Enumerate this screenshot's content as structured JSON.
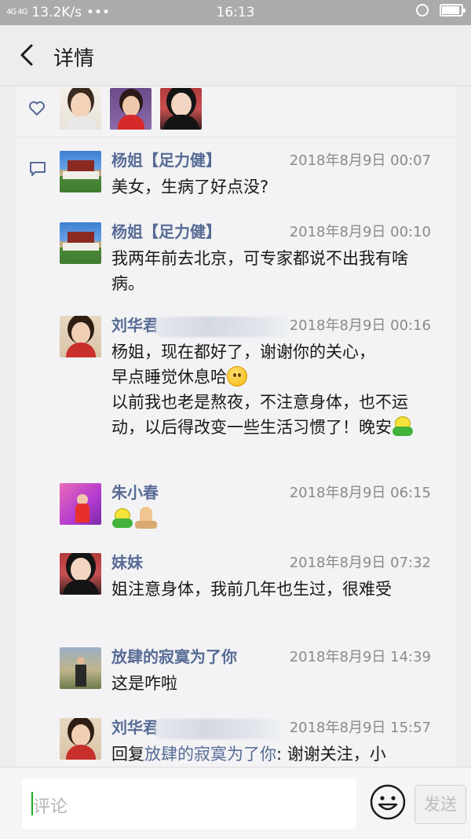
{
  "status_bar": {
    "network": "4G 4G",
    "speed": "13.2K/s",
    "dots": "•••",
    "time": "16:13"
  },
  "navbar": {
    "title": "详情"
  },
  "comments": [
    {
      "name": "杨姐【足力健】",
      "time": "2018年8月9日 00:07",
      "text": "美女，生病了好点没?"
    },
    {
      "name": "杨姐【足力健】",
      "time": "2018年8月9日 00:10",
      "text": "我两年前去北京，可专家都说不出我有啥病。"
    },
    {
      "name": "刘华君",
      "time": "2018年8月9日 00:16",
      "line1": "杨姐，现在都好了，谢谢你的关心，",
      "line2": "早点睡觉休息哈",
      "line3": "以前我也老是熬夜，不注意身体，也不运动，以后得改变一些生活习惯了！晚安"
    },
    {
      "name": "朱小春",
      "time": "2018年8月9日 06:15"
    },
    {
      "name": "妹妹",
      "time": "2018年8月9日 07:32",
      "text": "姐注意身体，我前几年也生过，很难受"
    },
    {
      "name": "放肆的寂寞为了你",
      "time": "2018年8月9日 14:39",
      "text": "这是咋啦"
    },
    {
      "name": "刘华君",
      "time": "2018年8月9日 15:57",
      "reply_prefix": "回复",
      "reply_to": "放肆的寂寞为了你",
      "reply_text": ": 谢谢关注，小"
    }
  ],
  "input": {
    "placeholder": "评论",
    "send_label": "发送"
  },
  "colors": {
    "link": "#576b95",
    "cursor": "#1aad19",
    "status_bar": "#ababab"
  }
}
